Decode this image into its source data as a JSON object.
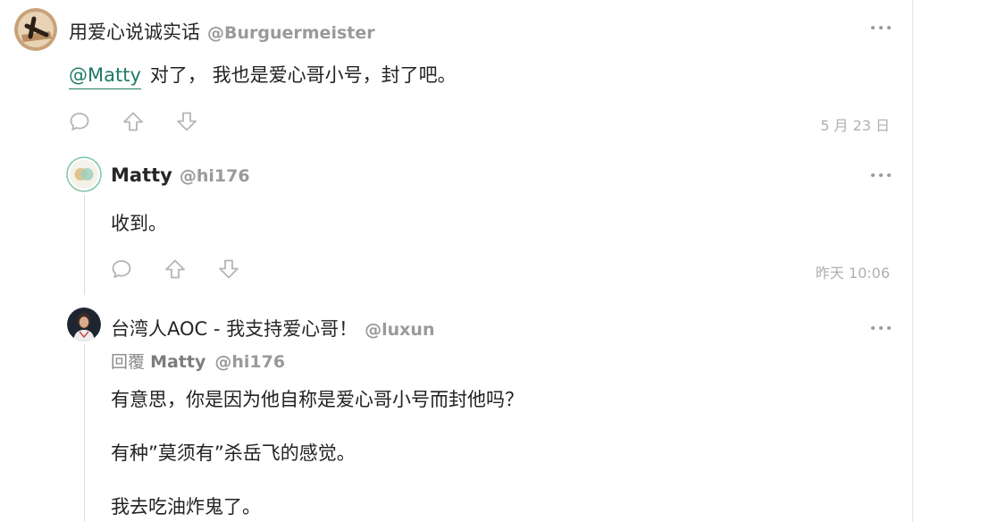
{
  "comments": [
    {
      "display_name": "用爱心说诚实话",
      "handle": "@Burguermeister",
      "mention": "@Matty",
      "text": "对了， 我也是爱心哥小号，封了吧。",
      "timestamp": "5 月 23 日",
      "avatar_icon": "cross-on-book-avatar"
    },
    {
      "display_name": "Matty",
      "handle": "@hi176",
      "text": "收到。",
      "timestamp": "昨天 10:06",
      "avatar_icon": "overlapping-circles-avatar"
    },
    {
      "display_name": "台湾人AOC - 我支持爱心哥！",
      "handle": "@luxun",
      "reply_label": "回覆",
      "reply_to_name": "Matty",
      "reply_to_handle": "@hi176",
      "paragraphs": [
        "有意思，你是因为他自称是爱心哥小号而封他吗？",
        "有种”莫须有”杀岳飞的感觉。",
        "我去吃油炸鬼了。"
      ],
      "avatar_icon": "portrait-avatar"
    }
  ],
  "colors": {
    "mention": "#1f7a66",
    "muted": "#9a9a9a",
    "timestamp": "#b0b0b0",
    "thread_line": "#dcdcdc"
  }
}
